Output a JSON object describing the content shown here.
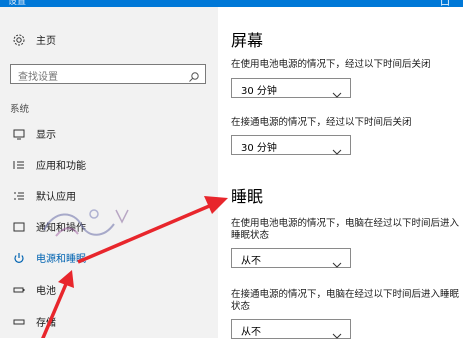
{
  "window": {
    "title": "设置",
    "min_glyph": "—",
    "max_glyph": "口"
  },
  "sidebar": {
    "home_label": "主页",
    "search_placeholder": "查找设置",
    "section": "系统",
    "items": [
      {
        "label": "显示",
        "icon": "monitor-icon"
      },
      {
        "label": "应用和功能",
        "icon": "list-icon"
      },
      {
        "label": "默认应用",
        "icon": "default-apps-icon"
      },
      {
        "label": "通知和操作",
        "icon": "notification-icon"
      },
      {
        "label": "电源和睡眠",
        "icon": "power-icon",
        "active": true
      },
      {
        "label": "电池",
        "icon": "battery-icon"
      },
      {
        "label": "存储",
        "icon": "storage-icon"
      }
    ]
  },
  "content": {
    "screen": {
      "heading": "屏幕",
      "battery_desc": "在使用电池电源的情况下，经过以下时间后关闭",
      "battery_value": "30 分钟",
      "plugged_desc": "在接通电源的情况下，经过以下时间后关闭",
      "plugged_value": "30 分钟"
    },
    "sleep": {
      "heading": "睡眠",
      "battery_desc": "在使用电池电源的情况下，电脑在经过以下时间后进入睡眠状态",
      "battery_value": "从不",
      "plugged_desc": "在接通电源的情况下，电脑在经过以下时间后进入睡眠状态",
      "plugged_value": "从不"
    }
  },
  "colors": {
    "accent": "#0063b1",
    "titlebar": "#0078d7",
    "annotation_arrow": "#e8262c",
    "sidebar_bg": "#f2f2f2"
  }
}
